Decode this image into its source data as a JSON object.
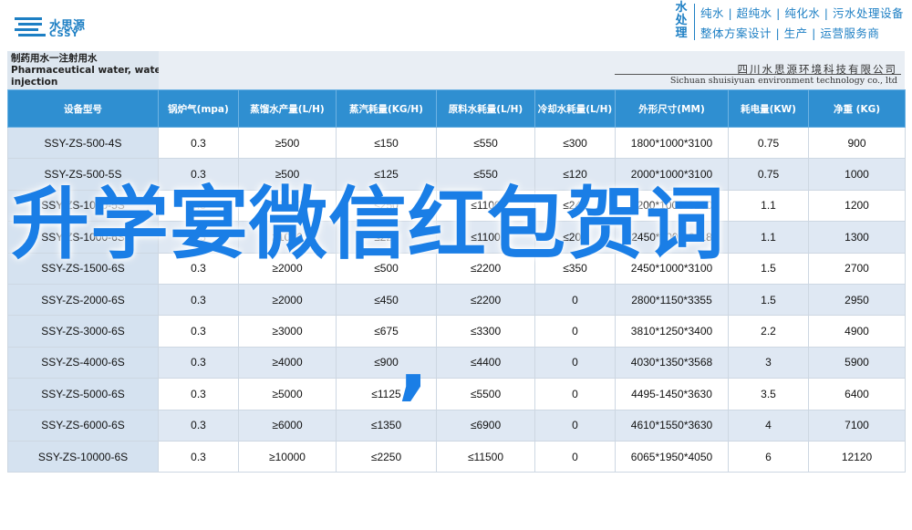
{
  "header": {
    "logo_cn": "水思源",
    "logo_en": "CSSY",
    "brand_vertical": "水处理",
    "brand_line1": "纯水 | 超纯水 | 纯化水 | 污水处理设备",
    "brand_line2": "整体方案设计 | 生产 | 运营服务商"
  },
  "title": {
    "line1": "制药用水一注射用水",
    "line2": "Pharmaceutical water, water for",
    "line3": "injection"
  },
  "company": {
    "cn": "四川水思源环境科技有限公司",
    "en": "Sichuan shuisiyuan environment technology co., ltd"
  },
  "table": {
    "columns": [
      "设备型号",
      "锅炉气(mpa)",
      "蒸馏水产量(L/H)",
      "蒸汽耗量(KG/H)",
      "原料水耗量(L/H)",
      "冷却水耗量(L/H)",
      "外形尺寸(MM)",
      "耗电量(KW)",
      "净重 (KG)"
    ],
    "rows": [
      [
        "SSY-ZS-500-4S",
        "0.3",
        "≥500",
        "≤150",
        "≤550",
        "≤300",
        "1800*1000*3100",
        "0.75",
        "900"
      ],
      [
        "SSY-ZS-500-5S",
        "0.3",
        "≥500",
        "≤125",
        "≤550",
        "≤120",
        "2000*1000*3100",
        "0.75",
        "1000"
      ],
      [
        "SSY-ZS-1000-5S",
        "0.3",
        "≥1000",
        "≤250",
        "≤1100",
        "≤240",
        "2200*1000*3100",
        "1.1",
        "1200"
      ],
      [
        "SSY-ZS-1000-6S",
        "0.3",
        "≥1000",
        "≤220",
        "≤1100",
        "≤200",
        "2450*1000*3118",
        "1.1",
        "1300"
      ],
      [
        "SSY-ZS-1500-6S",
        "0.3",
        "≥2000",
        "≤500",
        "≤2200",
        "≤350",
        "2450*1000*3100",
        "1.5",
        "2700"
      ],
      [
        "SSY-ZS-2000-6S",
        "0.3",
        "≥2000",
        "≤450",
        "≤2200",
        "0",
        "2800*1150*3355",
        "1.5",
        "2950"
      ],
      [
        "SSY-ZS-3000-6S",
        "0.3",
        "≥3000",
        "≤675",
        "≤3300",
        "0",
        "3810*1250*3400",
        "2.2",
        "4900"
      ],
      [
        "SSY-ZS-4000-6S",
        "0.3",
        "≥4000",
        "≤900",
        "≤4400",
        "0",
        "4030*1350*3568",
        "3",
        "5900"
      ],
      [
        "SSY-ZS-5000-6S",
        "0.3",
        "≥5000",
        "≤1125",
        "≤5500",
        "0",
        "4495-1450*3630",
        "3.5",
        "6400"
      ],
      [
        "SSY-ZS-6000-6S",
        "0.3",
        "≥6000",
        "≤1350",
        "≤6900",
        "0",
        "4610*1550*3630",
        "4",
        "7100"
      ],
      [
        "SSY-ZS-10000-6S",
        "0.3",
        "≥10000",
        "≤2250",
        "≤11500",
        "0",
        "6065*1950*4050",
        "6",
        "12120"
      ]
    ]
  },
  "overlay": {
    "headline": "升学宴微信红包贺词",
    "comma": ","
  },
  "colors": {
    "header_blue": "#2f8fd1",
    "brand_blue": "#1d7fc4",
    "overlay_blue": "#1a7ee6",
    "row_alt": "#dfe8f3"
  }
}
